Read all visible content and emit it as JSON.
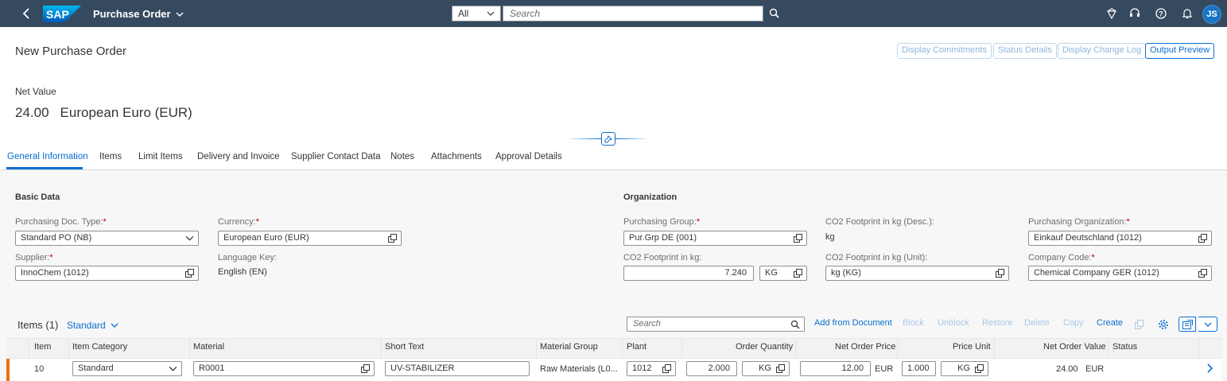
{
  "shell": {
    "app_title": "Purchase Order",
    "scope": "All",
    "search_placeholder": "Search",
    "avatar_initials": "JS",
    "brand_color": "#354a5f"
  },
  "header": {
    "page_title": "New Purchase Order",
    "actions": [
      "Display Commitments",
      "Status Details",
      "Display Change Log",
      "Output Preview"
    ],
    "net_value_label": "Net Value",
    "net_value_amount": "24.00",
    "net_value_currency": "European Euro (EUR)"
  },
  "tabs": [
    "General Information",
    "Items",
    "Limit Items",
    "Delivery and Invoice",
    "Supplier Contact Data",
    "Notes",
    "Attachments",
    "Approval Details"
  ],
  "basic_data": {
    "title": "Basic Data",
    "doc_type_label": "Purchasing Doc. Type:",
    "doc_type_value": "Standard PO (NB)",
    "currency_label": "Currency:",
    "currency_value": "European Euro (EUR)",
    "supplier_label": "Supplier:",
    "supplier_value": "InnoChem (1012)",
    "language_label": "Language Key:",
    "language_value": "English (EN)"
  },
  "organization": {
    "title": "Organization",
    "purch_group_label": "Purchasing Group:",
    "purch_group_value": "Pur.Grp DE (001)",
    "co2_desc_label": "CO2 Footprint in kg (Desc.):",
    "co2_desc_value": "kg",
    "purch_org_label": "Purchasing Organization:",
    "purch_org_value": "Einkauf Deutschland (1012)",
    "co2_label": "CO2 Footprint in kg:",
    "co2_value": "7.240",
    "co2_unit": "KG",
    "co2_unit_label": "CO2 Footprint in kg (Unit):",
    "co2_unit_value": "kg (KG)",
    "company_code_label": "Company Code:",
    "company_code_value": "Chemical Company GER (1012)"
  },
  "items": {
    "title": "Items (1)",
    "variant": "Standard",
    "search_placeholder": "Search",
    "toolbar": [
      "Add from Document",
      "Block",
      "Unblock",
      "Restore",
      "Delete",
      "Copy",
      "Create"
    ],
    "columns": [
      "Item",
      "Item Category",
      "Material",
      "Short Text",
      "Material Group",
      "Plant",
      "Order Quantity",
      "Net Order Price",
      "Price Unit",
      "Net Order Value",
      "Status"
    ],
    "row": {
      "item": "10",
      "category": "Standard",
      "material": "R0001",
      "short_text": "UV-STABILIZER",
      "material_group": "Raw Materials (L0...",
      "plant": "1012",
      "order_qty": "2.000",
      "order_unit": "KG",
      "net_price": "12.00",
      "net_price_currency": "EUR",
      "price_unit": "1.000",
      "price_unit_uom": "KG",
      "net_value": "24.00",
      "net_value_currency": "EUR",
      "status": ""
    }
  }
}
